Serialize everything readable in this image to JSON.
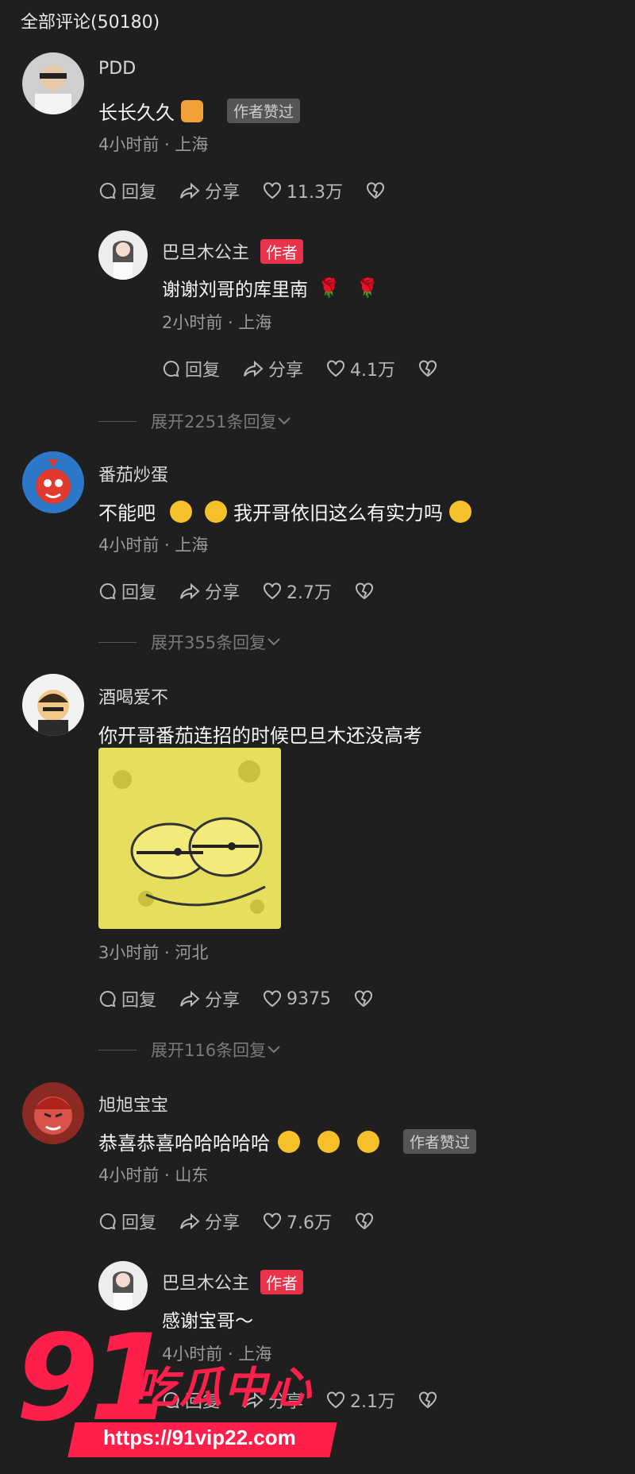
{
  "header": {
    "title": "全部评论(50180)"
  },
  "actions": {
    "reply": "回复",
    "share": "分享"
  },
  "comments": [
    {
      "user": "PDD",
      "text": "长长久久",
      "badge": "作者赞过",
      "meta": "4小时前 · 上海",
      "likes": "11.3万",
      "reply": {
        "user": "巴旦木公主",
        "badge": "作者",
        "text": "谢谢刘哥的库里南",
        "meta": "2小时前 · 上海",
        "likes": "4.1万"
      },
      "expand": "展开2251条回复"
    },
    {
      "user": "番茄炒蛋",
      "text_a": "不能吧",
      "text_b": "我开哥依旧这么有实力吗",
      "meta": "4小时前 · 上海",
      "likes": "2.7万",
      "expand": "展开355条回复"
    },
    {
      "user": "酒喝爱不",
      "text": "你开哥番茄连招的时候巴旦木还没高考",
      "meta": "3小时前 · 河北",
      "likes": "9375",
      "expand": "展开116条回复"
    },
    {
      "user": "旭旭宝宝",
      "text": "恭喜恭喜哈哈哈哈哈",
      "badge": "作者赞过",
      "meta": "4小时前 · 山东",
      "likes": "7.6万",
      "reply": {
        "user": "巴旦木公主",
        "badge": "作者",
        "text": "感谢宝哥～",
        "meta": "4小时前 · 上海",
        "likes": "2.1万"
      }
    }
  ],
  "watermark": {
    "big": "91",
    "title": "吃瓜中心",
    "url": "https://91vip22.com"
  },
  "colors": {
    "background": "#1f1f1f",
    "author_badge": "#e8334a",
    "watermark": "#ff1f4b"
  }
}
